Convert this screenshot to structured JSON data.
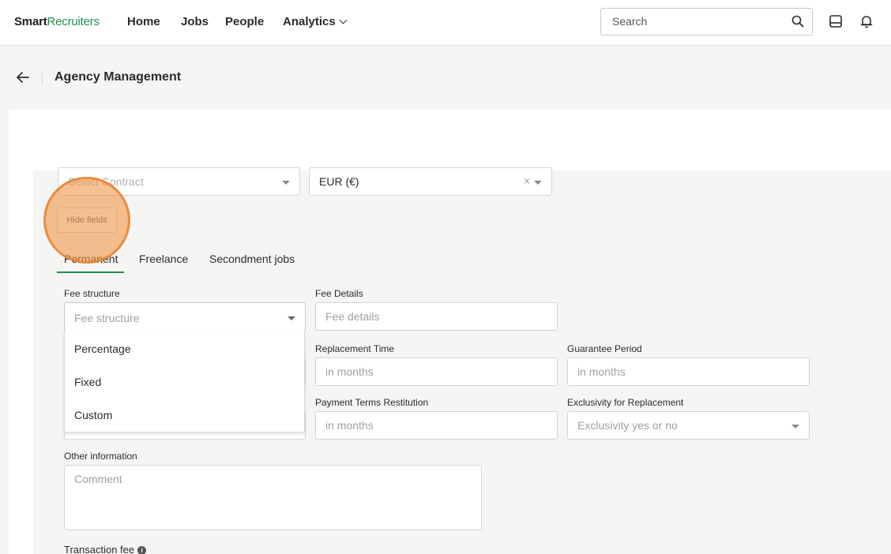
{
  "brand": {
    "smart": "Smart",
    "recruiters": "Recruiters"
  },
  "nav": {
    "home": "Home",
    "jobs": "Jobs",
    "people": "People",
    "analytics": "Analytics"
  },
  "search": {
    "placeholder": "Search"
  },
  "header": {
    "title": "Agency Management"
  },
  "contract": {
    "placeholder": "Select Contract"
  },
  "currency": {
    "value": "EUR (€)"
  },
  "hide_fields": {
    "label": "Hide fields"
  },
  "tabs": [
    {
      "label": "Permanent",
      "active": true
    },
    {
      "label": "Freelance"
    },
    {
      "label": "Secondment jobs"
    }
  ],
  "fee_structure": {
    "label": "Fee structure",
    "placeholder": "Fee structure",
    "options": [
      "Percentage",
      "Fixed",
      "Custom"
    ]
  },
  "fee_details": {
    "label": "Fee Details",
    "placeholder": "Fee details"
  },
  "replacement_time": {
    "label": "Replacement Time",
    "placeholder": "in months"
  },
  "guarantee_period": {
    "label": "Guarantee Period",
    "placeholder": "in months"
  },
  "payment_terms": {
    "label": "Payment Terms Restitution",
    "placeholder": "in months"
  },
  "exclusivity": {
    "label": "Exclusivity for Replacement",
    "placeholder": "Exclusivity yes or no"
  },
  "other_info": {
    "label": "Other information",
    "placeholder": "Comment"
  },
  "transaction_fee": {
    "label": "Transaction fee"
  },
  "colors": {
    "brand_green": "#1f8f4e",
    "highlight_orange": "#e88434"
  }
}
